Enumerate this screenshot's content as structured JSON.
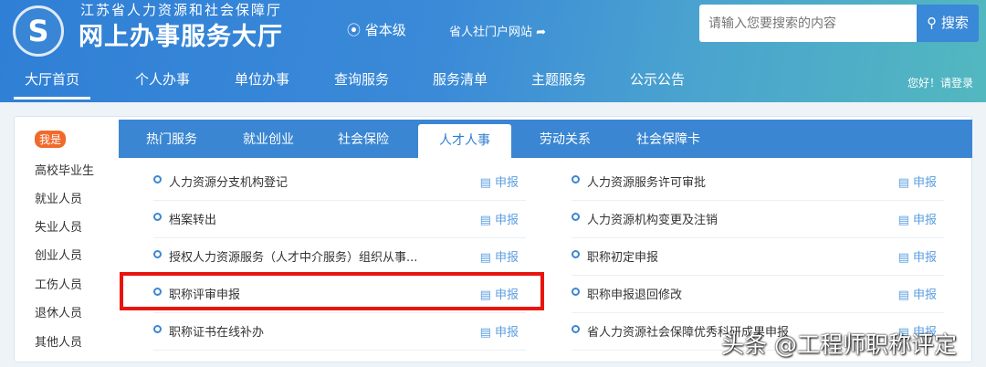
{
  "header": {
    "org": "江苏省人力资源和社会保障厅",
    "title": "网上办事服务大厅",
    "location": "省本级",
    "portal": "省人社门户网站",
    "search_placeholder": "请输入您要搜索的内容",
    "search_button": "搜索",
    "login": "您好！请登录"
  },
  "nav": [
    "大厅首页",
    "个人办事",
    "单位办事",
    "查询服务",
    "服务清单",
    "主题服务",
    "公示公告"
  ],
  "sidebar": {
    "badge": "我是",
    "items": [
      "高校毕业生",
      "就业人员",
      "失业人员",
      "创业人员",
      "工伤人员",
      "退休人员",
      "其他人员"
    ]
  },
  "tabs": [
    "热门服务",
    "就业创业",
    "社会保险",
    "人才人事",
    "劳动关系",
    "社会保障卡"
  ],
  "services_left": [
    "人力资源分支机构登记",
    "档案转出",
    "授权人力资源服务（人才中介服务）组织从事...",
    "职称评审申报",
    "职称证书在线补办"
  ],
  "services_right": [
    "人力资源服务许可审批",
    "人力资源机构变更及注销",
    "职称初定申报",
    "职称申报退回修改",
    "省人力资源社会保障优秀科研成果申报"
  ],
  "action_label": "申报",
  "watermark": "头条 @工程师职称评定"
}
